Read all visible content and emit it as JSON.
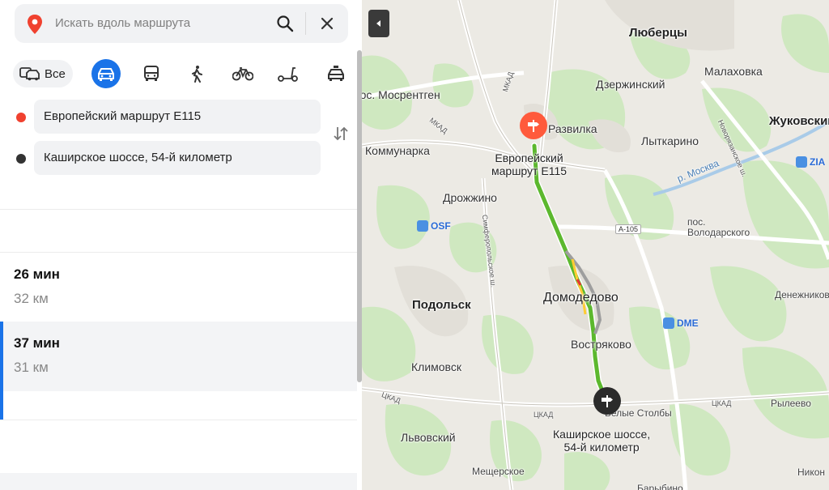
{
  "search": {
    "placeholder": "Искать вдоль маршрута"
  },
  "modes": {
    "all_label": "Все"
  },
  "points": {
    "from": "Европейский маршрут E115",
    "to": "Каширское шоссе, 54-й километр"
  },
  "routes": [
    {
      "time": "26 мин",
      "distance": "32 км",
      "selected": false
    },
    {
      "time": "37 мин",
      "distance": "31 км",
      "selected": true
    }
  ],
  "colors": {
    "accent": "#1a73e8",
    "start_pin": "#ff5a3c",
    "end_pin": "#2b2b2b",
    "route_main": "#5cb82e",
    "route_alt": "#9e9e9e"
  },
  "map": {
    "cities": {
      "lyubertsy": "Люберцы",
      "malakhovka": "Малаховка",
      "dzerzhinsky": "Дзержинский",
      "mosrentgen": "пос. Мосрентген",
      "razvilka": "Развилка",
      "zhukovsky": "Жуковский",
      "kommunarka": "Коммунарка",
      "lytkarino": "Лыткарино",
      "drozhzhino": "Дрожжино",
      "volodarskogo": "пос. Володарского",
      "podolsk": "Подольск",
      "domodedovo": "Домодедово",
      "denezhnikovo": "Денежниково",
      "vostryakovo": "Востряково",
      "klimovsk": "Климовск",
      "rileevo": "Рылеево",
      "belye_stolby": "Белые Столбы",
      "lvovsky": "Львовский",
      "meshcherskoe": "Мещерское",
      "nikon": "Никон",
      "barybino": "Барыбино"
    },
    "rivers": {
      "moskva": "р. Москва"
    },
    "roads": {
      "mkad": "МКАД",
      "tsk": "ЦКАД",
      "simferopolskoe": "Симферопольское ш.",
      "novoryazanskoe": "Новорязанское ш.",
      "a105": "A-105"
    },
    "airports": {
      "osf": "OSF",
      "dme": "DME",
      "zia": "ZIA"
    },
    "start_label_line1": "Европейский",
    "start_label_line2": "маршрут E115",
    "end_label_line1": "Каширское шоссе,",
    "end_label_line2": "54-й километр"
  }
}
